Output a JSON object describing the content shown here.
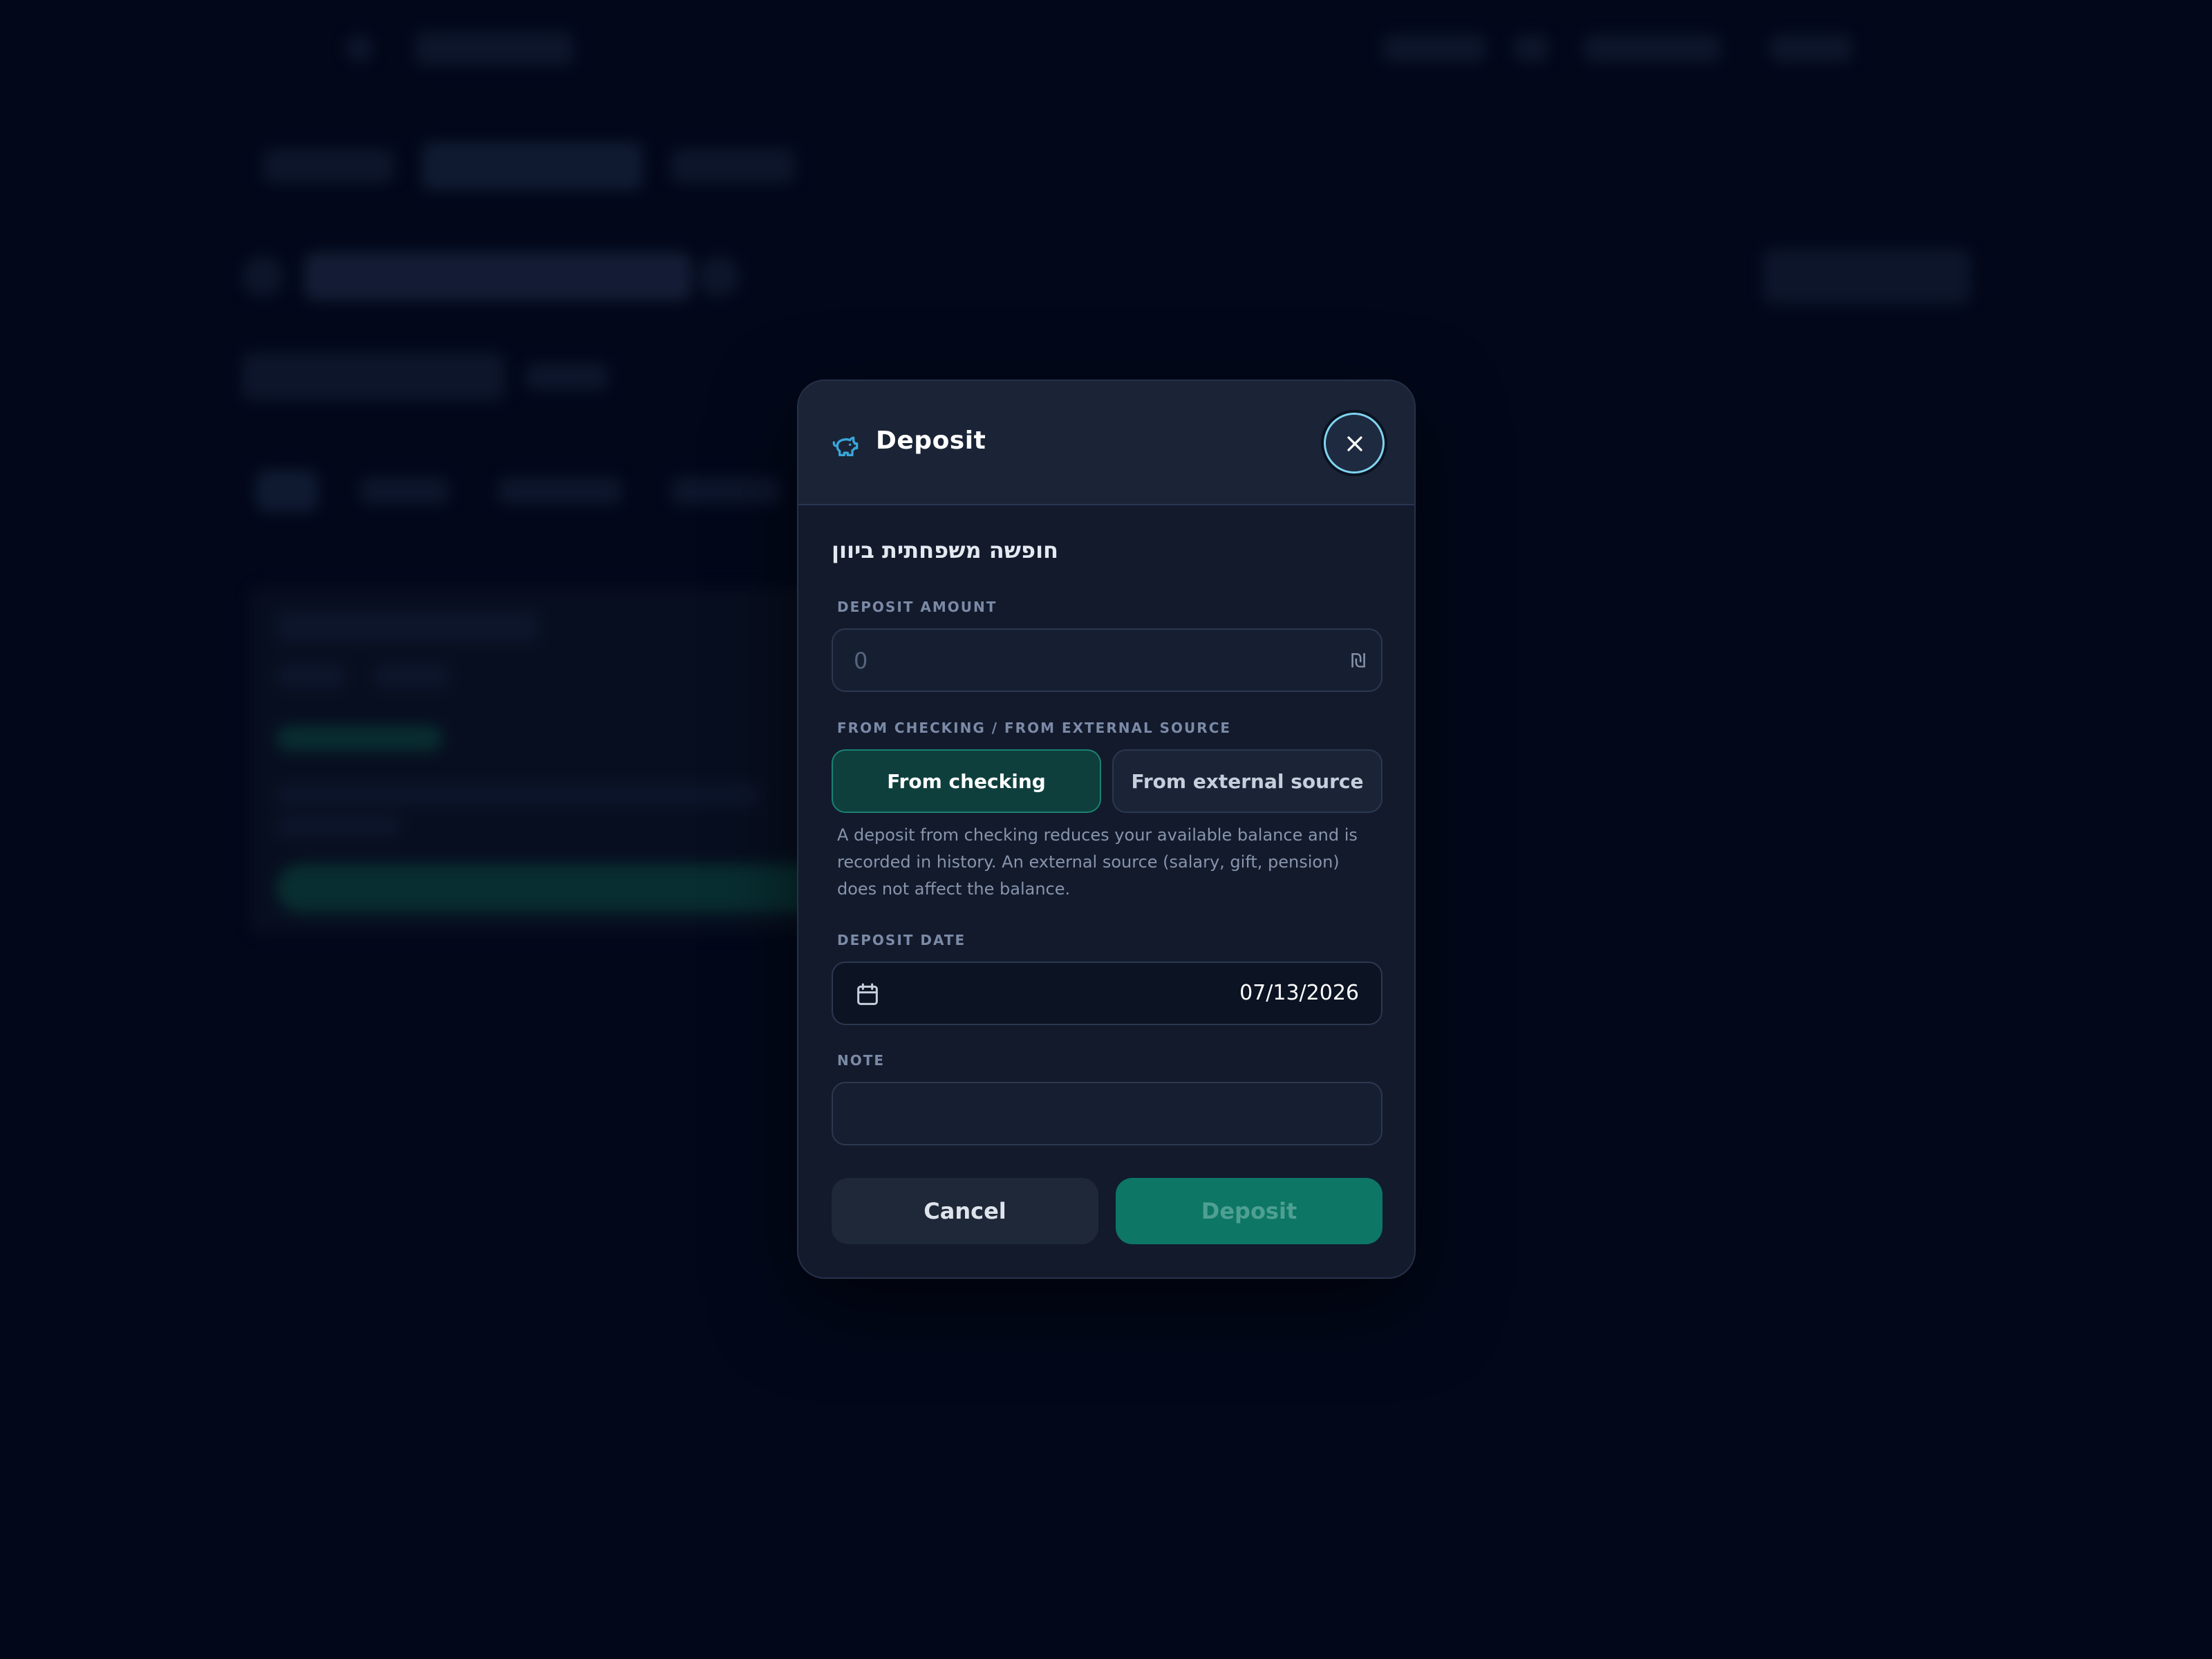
{
  "modal": {
    "title": "Deposit",
    "goal_name": "חופשה משפחתית ביוון",
    "amount": {
      "label": "DEPOSIT AMOUNT",
      "placeholder": "0",
      "currency": "₪"
    },
    "source": {
      "label": "FROM CHECKING / FROM EXTERNAL SOURCE",
      "options": [
        "From checking",
        "From external source"
      ],
      "selected": "From checking",
      "help": "A deposit from checking reduces your available balance and is recorded in history. An external source (salary, gift, pension) does not affect the balance."
    },
    "date": {
      "label": "DEPOSIT DATE",
      "value": "07/13/2026"
    },
    "note": {
      "label": "NOTE",
      "value": ""
    },
    "actions": {
      "cancel": "Cancel",
      "deposit": "Deposit"
    }
  },
  "colors": {
    "accent": "#0d7665",
    "accent_selected_bg": "#0e3f3d",
    "modal_bg": "#121a2c",
    "page_bg": "#02081a",
    "icon_blue": "#3aa6d8"
  },
  "icons": {
    "header": "piggy-bank-icon",
    "close": "close-icon",
    "date": "calendar-icon"
  }
}
